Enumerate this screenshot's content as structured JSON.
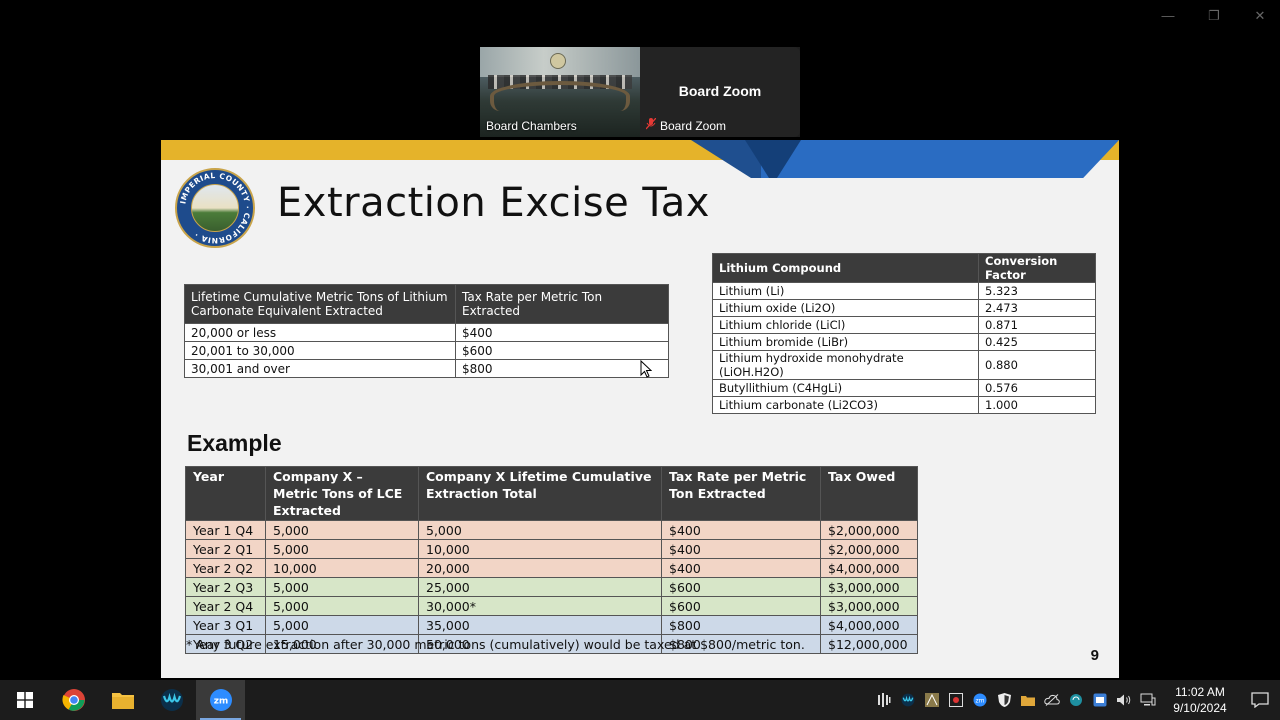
{
  "window_controls": {
    "minimize": "—",
    "restore": "❐",
    "close": "✕"
  },
  "participants": [
    {
      "label": "Board Chambers",
      "type": "video"
    },
    {
      "name": "Board Zoom",
      "label": "Board Zoom",
      "type": "name",
      "muted": true
    }
  ],
  "slide": {
    "title": "Extraction Excise Tax",
    "logo_text": "IMPERIAL COUNTY CALIFORNIA",
    "rate_table": {
      "headers": [
        "Lifetime Cumulative Metric Tons of Lithium Carbonate Equivalent Extracted",
        "Tax Rate per Metric Ton Extracted"
      ],
      "rows": [
        [
          "20,000 or less",
          "$400"
        ],
        [
          "20,001 to 30,000",
          "$600"
        ],
        [
          "30,001 and over",
          "$800"
        ]
      ]
    },
    "conversion_table": {
      "headers": [
        "Lithium Compound",
        "Conversion Factor"
      ],
      "rows": [
        [
          "Lithium (Li)",
          "5.323"
        ],
        [
          "Lithium oxide (Li2O)",
          "2.473"
        ],
        [
          "Lithium chloride (LiCl)",
          "0.871"
        ],
        [
          "Lithium bromide (LiBr)",
          "0.425"
        ],
        [
          "Lithium hydroxide monohydrate (LiOH.H2O)",
          "0.880"
        ],
        [
          "Butyllithium (C4HgLi)",
          "0.576"
        ],
        [
          "Lithium carbonate (Li2CO3)",
          "1.000"
        ]
      ]
    },
    "example": {
      "title": "Example",
      "headers": [
        "Year",
        "Company X – Metric Tons of LCE Extracted",
        "Company X Lifetime Cumulative Extraction Total",
        "Tax Rate per Metric Ton Extracted",
        "Tax Owed"
      ],
      "rows": [
        {
          "tier": "orange",
          "cells": [
            "Year 1 Q4",
            "5,000",
            "5,000",
            "$400",
            "$2,000,000"
          ]
        },
        {
          "tier": "orange",
          "cells": [
            "Year 2 Q1",
            "5,000",
            "10,000",
            "$400",
            "$2,000,000"
          ]
        },
        {
          "tier": "orange",
          "cells": [
            "Year 2 Q2",
            "10,000",
            "20,000",
            "$400",
            "$4,000,000"
          ]
        },
        {
          "tier": "green",
          "cells": [
            "Year 2 Q3",
            "5,000",
            "25,000",
            "$600",
            "$3,000,000"
          ]
        },
        {
          "tier": "green",
          "cells": [
            "Year 2 Q4",
            "5,000",
            "30,000*",
            "$600",
            "$3,000,000"
          ]
        },
        {
          "tier": "blue",
          "cells": [
            "Year 3 Q1",
            "5,000",
            "35,000",
            "$800",
            "$4,000,000"
          ]
        },
        {
          "tier": "blue",
          "cells": [
            "Year 3 Q2",
            "15,000",
            "50,000",
            "$800",
            "$12,000,000"
          ]
        }
      ]
    },
    "footnote": "* Any future extraction after 30,000 metric tons (cumulatively) would be taxed at $800/metric ton.",
    "page_number": "9"
  },
  "taskbar": {
    "apps": [
      "start-icon",
      "chrome-icon",
      "file-explorer-icon",
      "webex-icon",
      "zoom-icon"
    ],
    "active_app": "zoom-icon",
    "zoom_glyph": "zm",
    "clock_time": "11:02 AM",
    "clock_date": "9/10/2024"
  },
  "colors": {
    "gold": "#e5b32a",
    "blue": "#2a6cc2",
    "tier_orange": "#f2d5c6",
    "tier_green": "#d7e6c8",
    "tier_blue": "#cdd9e8"
  }
}
